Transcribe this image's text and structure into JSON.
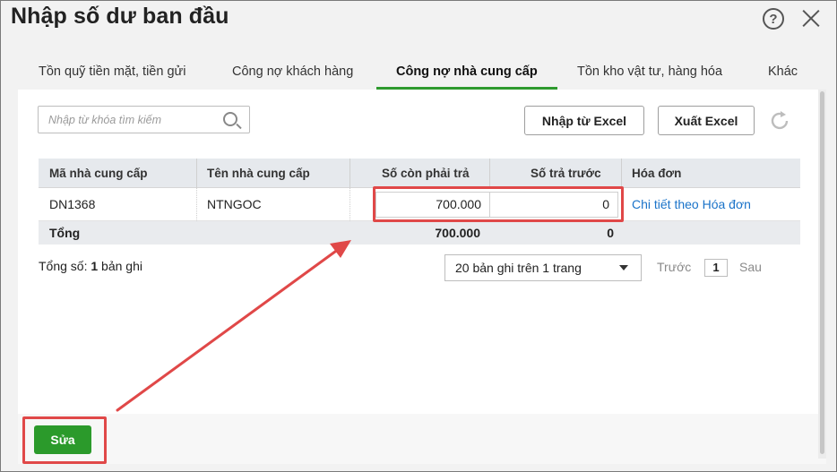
{
  "window": {
    "title": "Nhập số dư ban đầu",
    "help_icon": "help-icon",
    "close_icon": "close-icon"
  },
  "tabs": [
    {
      "label": "Tồn quỹ tiền mặt, tiền gửi",
      "active": false
    },
    {
      "label": "Công nợ khách hàng",
      "active": false
    },
    {
      "label": "Công nợ nhà cung cấp",
      "active": true
    },
    {
      "label": "Tồn kho vật tư, hàng hóa",
      "active": false
    },
    {
      "label": "Khác",
      "active": false
    }
  ],
  "toolbar": {
    "search_placeholder": "Nhập từ khóa tìm kiếm",
    "search_value": "",
    "import_label": "Nhập từ Excel",
    "export_label": "Xuất Excel",
    "refresh_icon": "refresh-icon"
  },
  "grid": {
    "columns": [
      "Mã nhà cung cấp",
      "Tên nhà cung cấp",
      "Số còn phải trả",
      "Số trả trước",
      "Hóa đơn"
    ],
    "rows": [
      {
        "code": "DN1368",
        "name": "NTNGOC",
        "payable": "700.000",
        "prepaid": "0",
        "invoice_link": "Chi tiết theo Hóa đơn"
      }
    ],
    "total": {
      "label": "Tổng",
      "payable": "700.000",
      "prepaid": "0"
    }
  },
  "footer": {
    "record_count_prefix": "Tổng số: ",
    "record_count_value": "1",
    "record_count_suffix": " bản ghi",
    "page_size": "20 bản ghi trên 1 trang",
    "prev_label": "Trước",
    "current_page": "1",
    "next_label": "Sau"
  },
  "actions": {
    "edit_label": "Sửa"
  },
  "colors": {
    "accent": "#2e9a2e",
    "highlight": "#e04848",
    "link": "#1a73c9"
  }
}
